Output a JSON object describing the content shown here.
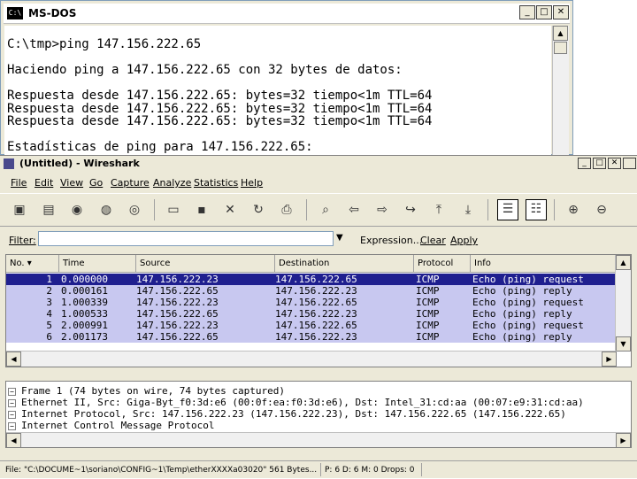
{
  "dos": {
    "title": "MS-DOS",
    "icon_text": "C:\\",
    "lines": [
      "C:\\tmp>ping 147.156.222.65",
      "",
      "Haciendo ping a 147.156.222.65 con 32 bytes de datos:",
      "",
      "Respuesta desde 147.156.222.65: bytes=32 tiempo<1m TTL=64",
      "Respuesta desde 147.156.222.65: bytes=32 tiempo<1m TTL=64",
      "Respuesta desde 147.156.222.65: bytes=32 tiempo<1m TTL=64",
      "",
      "Estadísticas de ping para 147.156.222.65:"
    ]
  },
  "wireshark": {
    "title": "(Untitled) - Wireshark",
    "menu": [
      "File",
      "Edit",
      "View",
      "Go",
      "Capture",
      "Analyze",
      "Statistics",
      "Help"
    ],
    "filter": {
      "label": "Filter:",
      "value": "",
      "expression": "Expression...",
      "clear": "Clear",
      "apply": "Apply"
    },
    "columns": [
      "No. ▾",
      "Time",
      "Source",
      "Destination",
      "Protocol",
      "Info"
    ],
    "packets": [
      {
        "no": "1",
        "time": "0.000000",
        "src": "147.156.222.23",
        "dst": "147.156.222.65",
        "proto": "ICMP",
        "info": "Echo (ping) request"
      },
      {
        "no": "2",
        "time": "0.000161",
        "src": "147.156.222.65",
        "dst": "147.156.222.23",
        "proto": "ICMP",
        "info": "Echo (ping) reply"
      },
      {
        "no": "3",
        "time": "1.000339",
        "src": "147.156.222.23",
        "dst": "147.156.222.65",
        "proto": "ICMP",
        "info": "Echo (ping) request"
      },
      {
        "no": "4",
        "time": "1.000533",
        "src": "147.156.222.65",
        "dst": "147.156.222.23",
        "proto": "ICMP",
        "info": "Echo (ping) reply"
      },
      {
        "no": "5",
        "time": "2.000991",
        "src": "147.156.222.23",
        "dst": "147.156.222.65",
        "proto": "ICMP",
        "info": "Echo (ping) request"
      },
      {
        "no": "6",
        "time": "2.001173",
        "src": "147.156.222.65",
        "dst": "147.156.222.23",
        "proto": "ICMP",
        "info": "Echo (ping) reply"
      }
    ],
    "details": [
      "Frame 1 (74 bytes on wire, 74 bytes captured)",
      "Ethernet II, Src: Giga-Byt_f0:3d:e6 (00:0f:ea:f0:3d:e6), Dst: Intel_31:cd:aa (00:07:e9:31:cd:aa)",
      "Internet Protocol, Src: 147.156.222.23 (147.156.222.23), Dst: 147.156.222.65 (147.156.222.65)",
      "Internet Control Message Protocol"
    ],
    "status": {
      "file": "File: \"C:\\DOCUME~1\\soriano\\CONFIG~1\\Temp\\etherXXXXa03020\" 561 Bytes...",
      "counts": "P: 6 D: 6 M: 0 Drops: 0"
    },
    "colors": {
      "row_bg": "#c8c8f0",
      "selected_bg": "#1f1f8f"
    }
  }
}
